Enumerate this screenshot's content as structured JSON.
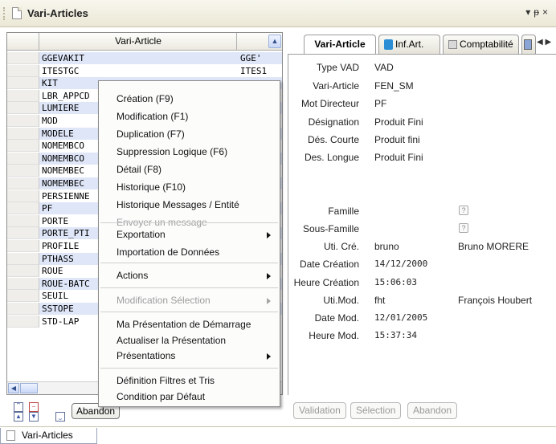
{
  "window": {
    "title": "Vari-Articles"
  },
  "left_grid": {
    "column_header": "Vari-Article",
    "rows": [
      {
        "c1": "GGEVAKIT",
        "c2": "GGE'"
      },
      {
        "c1": "ITESTGC",
        "c2": "ITES1"
      },
      {
        "c1": "KIT",
        "c2": ""
      },
      {
        "c1": "LBR_APPCD",
        "c2": ""
      },
      {
        "c1": "LUMIERE",
        "c2": ""
      },
      {
        "c1": "MOD",
        "c2": ""
      },
      {
        "c1": "MODELE",
        "c2": ""
      },
      {
        "c1": "NOMEMBCO",
        "c2": ""
      },
      {
        "c1": "NOMEMBCO",
        "c2": ""
      },
      {
        "c1": "NOMEMBEC",
        "c2": ""
      },
      {
        "c1": "NOMEMBEC",
        "c2": ""
      },
      {
        "c1": "PERSIENNE",
        "c2": ""
      },
      {
        "c1": "PF",
        "c2": ""
      },
      {
        "c1": "PORTE",
        "c2": ""
      },
      {
        "c1": "PORTE_PTI",
        "c2": ""
      },
      {
        "c1": "PROFILE",
        "c2": ""
      },
      {
        "c1": "PTHASS",
        "c2": ""
      },
      {
        "c1": "ROUE",
        "c2": ""
      },
      {
        "c1": "ROUE-BATC",
        "c2": ""
      },
      {
        "c1": "SEUIL",
        "c2": ""
      },
      {
        "c1": "SSTOPE",
        "c2": ""
      },
      {
        "c1": "STD-LAP",
        "c2": ""
      }
    ],
    "abandon_label": "Abandon"
  },
  "tabs": [
    {
      "label": "Vari-Article",
      "active": true
    },
    {
      "label": "Inf.Art.",
      "active": false
    },
    {
      "label": "Comptabilité",
      "active": false
    }
  ],
  "form": {
    "type_vad": {
      "label": "Type VAD",
      "value": "VAD"
    },
    "vari_article": {
      "label": "Vari-Article",
      "value": "FEN_SM"
    },
    "mot_directeur": {
      "label": "Mot Directeur",
      "value": "PF"
    },
    "designation": {
      "label": "Désignation",
      "value": "Produit Fini"
    },
    "des_courte": {
      "label": "Dés. Courte",
      "value": "Produit fini"
    },
    "des_longue": {
      "label": "Des. Longue",
      "value": "Produit Fini"
    },
    "famille": {
      "label": "Famille",
      "value": ""
    },
    "sous_famille": {
      "label": "Sous-Famille",
      "value": ""
    },
    "uti_cre": {
      "label": "Uti. Cré.",
      "value": "bruno",
      "name": "Bruno MORERE"
    },
    "date_creation": {
      "label": "Date Création",
      "value": "14/12/2000"
    },
    "heure_creation": {
      "label": "Heure Création",
      "value": "15:06:03"
    },
    "uti_mod": {
      "label": "Uti.Mod.",
      "value": "fht",
      "name": "François Houbert"
    },
    "date_mod": {
      "label": "Date Mod.",
      "value": "12/01/2005"
    },
    "heure_mod": {
      "label": "Heure Mod.",
      "value": "15:37:34"
    },
    "help_glyph": "?"
  },
  "right_buttons": {
    "validation": "Validation",
    "selection": "Sélection",
    "abandon": "Abandon"
  },
  "context_menu": {
    "creation": "Création (F9)",
    "modification": "Modification (F1)",
    "duplication": "Duplication (F7)",
    "suppression": "Suppression Logique (F6)",
    "detail": "Détail (F8)",
    "historique": "Historique (F10)",
    "historique_messages": "Historique Messages / Entité",
    "envoyer_message": "Envoyer un message",
    "exportation": "Exportation",
    "importation": "Importation de Données",
    "actions": "Actions",
    "modification_selection": "Modification Sélection",
    "ma_presentation": "Ma Présentation de Démarrage",
    "actualiser": "Actualiser la Présentation",
    "presentations": "Présentations",
    "definition_filtres": "Définition Filtres et Tris",
    "condition_defaut": "Condition par Défaut"
  },
  "bottom_tab": {
    "label": "Vari-Articles"
  },
  "colors": {
    "highlight_row": "#dee6f8",
    "accent": "#3b5aa6"
  },
  "icons": {
    "title_doc": "document-icon",
    "title_pin": "pin-icon",
    "title_close": "close-icon",
    "tab_info": "info-book-icon",
    "tab_compta": "table-icon"
  }
}
